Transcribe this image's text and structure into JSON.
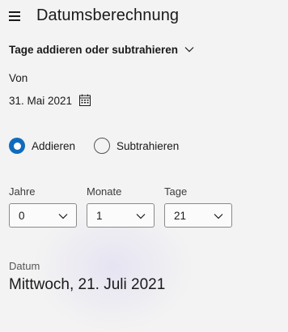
{
  "header": {
    "title": "Datumsberechnung",
    "menu_icon": "hamburger-menu-icon"
  },
  "mode_selector": {
    "label": "Tage addieren oder subtrahieren",
    "icon": "chevron-down-icon"
  },
  "from": {
    "label": "Von",
    "date": "31. Mai 2021",
    "icon": "calendar-icon"
  },
  "operation": {
    "add_label": "Addieren",
    "subtract_label": "Subtrahieren",
    "selected": "Addieren"
  },
  "offsets": {
    "years": {
      "label": "Jahre",
      "value": "0"
    },
    "months": {
      "label": "Monate",
      "value": "1"
    },
    "days": {
      "label": "Tage",
      "value": "21"
    }
  },
  "result": {
    "label": "Datum",
    "value": "Mittwoch, 21. Juli 2021"
  },
  "colors": {
    "accent": "#0f6cbd",
    "background": "#f3f3f3",
    "text": "#1a1a1a"
  }
}
